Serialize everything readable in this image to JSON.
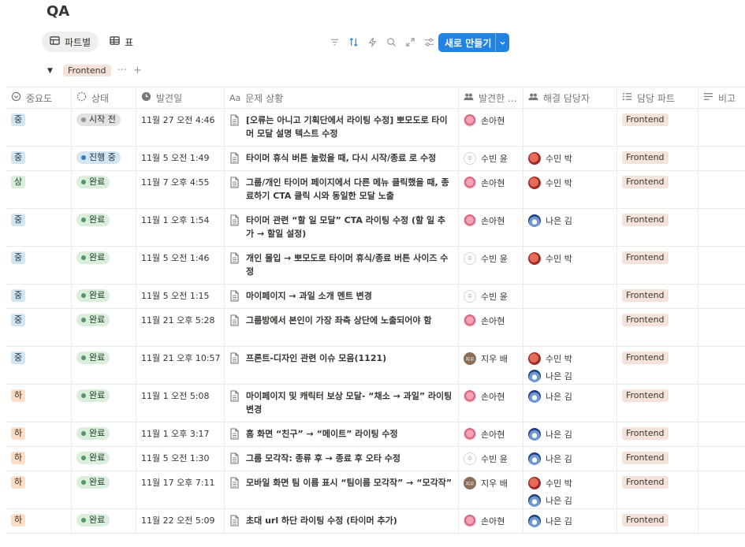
{
  "title": "QA",
  "views": [
    {
      "label": "파트별",
      "icon": "board-icon"
    },
    {
      "label": "표",
      "icon": "table-icon"
    }
  ],
  "toolbar": {
    "icons": [
      "filter-icon",
      "sort-icon",
      "automation-icon",
      "search-icon",
      "expand-icon",
      "settings-icon"
    ],
    "new_label": "새로 만들기"
  },
  "group": {
    "label": "Frontend",
    "more": "···",
    "add": "+"
  },
  "columns": [
    "중요도",
    "상태",
    "발견일",
    "문제 상황",
    "발견한 ...",
    "해결 담당자",
    "담당 파트",
    "비고"
  ],
  "rows": [
    {
      "priority": "중",
      "pclass": "mid",
      "status": "시작 전",
      "sclass": "todo",
      "date": "11월 27 오전 4:46",
      "title": "[오류는 아니고 기획단에서 라이팅 수정] 뽀모도로 타이머 모달 설명 텍스트 수정",
      "reporter": {
        "name": "손아현",
        "av": "av-pink",
        "initial": ""
      },
      "assignees": [],
      "part": "Frontend",
      "h": 48
    },
    {
      "priority": "중",
      "pclass": "mid",
      "status": "진행 중",
      "sclass": "prog",
      "date": "11월 5 오전 1:49",
      "title": "타이머 휴식 버튼 눌렀을 때, 다시 시작/종료 로 수정",
      "reporter": {
        "name": "수빈 윤",
        "av": "av-gray",
        "initial": "수"
      },
      "assignees": [
        {
          "name": "수민 박",
          "av": "av-red",
          "initial": ""
        }
      ],
      "part": "Frontend",
      "h": 31
    },
    {
      "priority": "상",
      "pclass": "high",
      "status": "완료",
      "sclass": "done",
      "date": "11월 7 오후 4:55",
      "title": "그룹/개인 타이머 페이지에서 다른 메뉴 클릭했을 때, 종료하기 CTA 클릭 시와 동일한 모달 노출",
      "reporter": {
        "name": "손아현",
        "av": "av-pink",
        "initial": ""
      },
      "assignees": [
        {
          "name": "수민 박",
          "av": "av-red",
          "initial": ""
        }
      ],
      "part": "Frontend",
      "h": 48
    },
    {
      "priority": "중",
      "pclass": "mid",
      "status": "완료",
      "sclass": "done",
      "date": "11월 1 오후 1:54",
      "title": "타이머 관련 “할 일 모달” CTA 라이팅 수정 (할 일 추가 → 할일 설정)",
      "reporter": {
        "name": "손아현",
        "av": "av-pink",
        "initial": ""
      },
      "assignees": [
        {
          "name": "나은 김",
          "av": "av-blue",
          "initial": ""
        }
      ],
      "part": "Frontend",
      "h": 48
    },
    {
      "priority": "중",
      "pclass": "mid",
      "status": "완료",
      "sclass": "done",
      "date": "11월 5 오전 1:46",
      "title": "개인 몰입 → 뽀모도로 타이머 휴식/종료 버튼 사이즈 수정",
      "reporter": {
        "name": "수빈 윤",
        "av": "av-gray",
        "initial": "수"
      },
      "assignees": [
        {
          "name": "수민 박",
          "av": "av-red",
          "initial": ""
        }
      ],
      "part": "Frontend",
      "h": 48
    },
    {
      "priority": "중",
      "pclass": "mid",
      "status": "완료",
      "sclass": "done",
      "date": "11월 5 오전 1:15",
      "title": "마이페이지 → 과일 소개 멘트 변경",
      "reporter": {
        "name": "수빈 윤",
        "av": "av-gray",
        "initial": "수"
      },
      "assignees": [],
      "part": "Frontend",
      "h": 31
    },
    {
      "priority": "중",
      "pclass": "mid",
      "status": "완료",
      "sclass": "done",
      "date": "11월 21 오후 5:28",
      "title": "그룹방에서 본인이 가장 좌측 상단에 노출되어야 함",
      "reporter": {
        "name": "손아현",
        "av": "av-pink",
        "initial": ""
      },
      "assignees": [],
      "part": "Frontend",
      "h": 48
    },
    {
      "priority": "중",
      "pclass": "mid",
      "status": "완료",
      "sclass": "done",
      "date": "11월 21 오후 10:57",
      "title": "프론트-디자인 관련 이슈 모음(1121)",
      "reporter": {
        "name": "지우 배",
        "av": "av-brown",
        "initial": "지우"
      },
      "assignees": [
        {
          "name": "수민 박",
          "av": "av-red",
          "initial": ""
        },
        {
          "name": "나은 김",
          "av": "av-blue",
          "initial": ""
        }
      ],
      "part": "Frontend",
      "h": 48
    },
    {
      "priority": "하",
      "pclass": "low",
      "status": "완료",
      "sclass": "done",
      "date": "11월 1 오전 5:08",
      "title": "마이페이지 및 캐릭터 보상 모달- “채소 → 과일” 라이팅 변경",
      "reporter": {
        "name": "손아현",
        "av": "av-pink",
        "initial": ""
      },
      "assignees": [
        {
          "name": "나은 김",
          "av": "av-blue",
          "initial": ""
        }
      ],
      "part": "Frontend",
      "h": 48
    },
    {
      "priority": "하",
      "pclass": "low",
      "status": "완료",
      "sclass": "done",
      "date": "11월 1 오후 3:17",
      "title": "홈 화면 “친구” → “메이트” 라이팅 수정",
      "reporter": {
        "name": "손아현",
        "av": "av-pink",
        "initial": ""
      },
      "assignees": [
        {
          "name": "나은 김",
          "av": "av-blue",
          "initial": ""
        }
      ],
      "part": "Frontend",
      "h": 31
    },
    {
      "priority": "하",
      "pclass": "low",
      "status": "완료",
      "sclass": "done",
      "date": "11월 5 오전 1:30",
      "title": "그룹 모각작: 종류 후 → 종료 후 오타 수정",
      "reporter": {
        "name": "수빈 윤",
        "av": "av-gray",
        "initial": "수"
      },
      "assignees": [
        {
          "name": "나은 김",
          "av": "av-blue",
          "initial": ""
        }
      ],
      "part": "Frontend",
      "h": 31
    },
    {
      "priority": "하",
      "pclass": "low",
      "status": "완료",
      "sclass": "done",
      "date": "11월 17 오후 7:11",
      "title": "모바일 화면 팀 이름 표시 “팀이름 모각작” → “모각작”",
      "reporter": {
        "name": "지우 배",
        "av": "av-brown",
        "initial": "지우"
      },
      "assignees": [
        {
          "name": "수민 박",
          "av": "av-red",
          "initial": ""
        },
        {
          "name": "나은 김",
          "av": "av-blue",
          "initial": ""
        }
      ],
      "part": "Frontend",
      "h": 48
    },
    {
      "priority": "하",
      "pclass": "low",
      "status": "완료",
      "sclass": "done",
      "date": "11월 22 오전 5:09",
      "title": "초대 url 하단 라이팅 수정 (타이머 추가)",
      "reporter": {
        "name": "손아현",
        "av": "av-pink",
        "initial": ""
      },
      "assignees": [
        {
          "name": "나은 김",
          "av": "av-blue",
          "initial": ""
        }
      ],
      "part": "Frontend",
      "h": 31
    }
  ]
}
